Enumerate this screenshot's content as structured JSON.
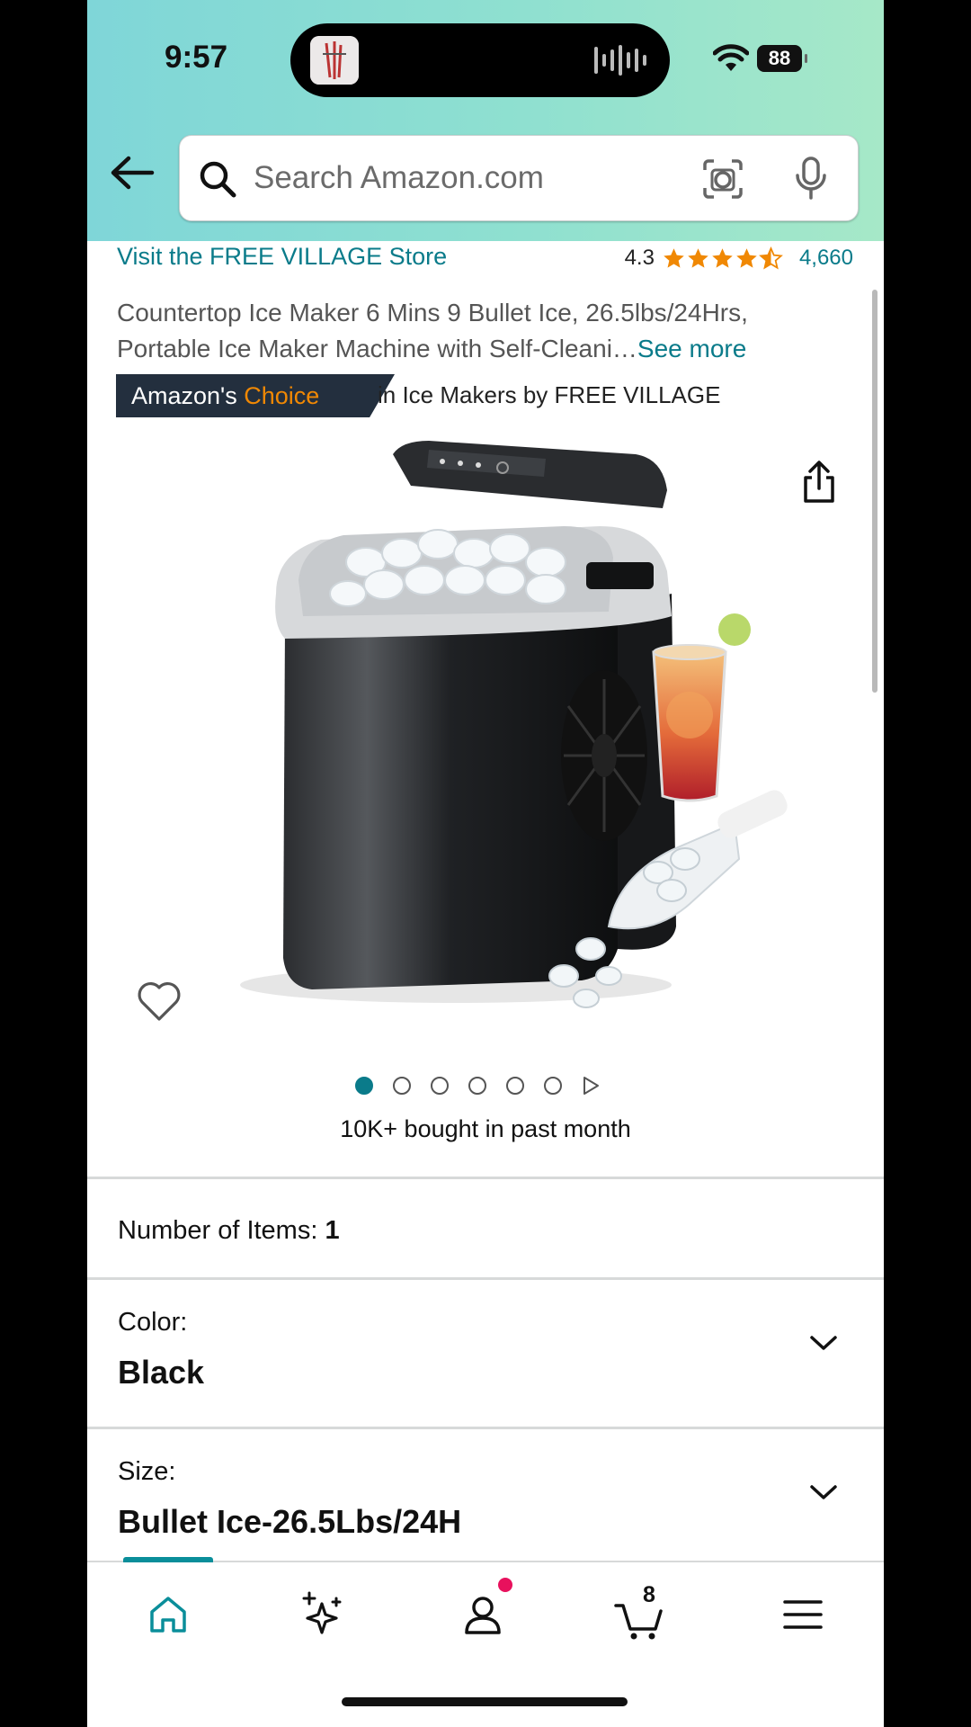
{
  "status_bar": {
    "time": "9:57",
    "battery": "88"
  },
  "search": {
    "placeholder": "Search Amazon.com"
  },
  "product": {
    "store_link": "Visit the FREE VILLAGE Store",
    "rating": "4.3",
    "rating_count": "4,660",
    "title": "Countertop Ice Maker 6 Mins 9 Bullet Ice, 26.5lbs/24Hrs, Portable Ice Maker Machine with Self-Cleani…",
    "see_more": "See more",
    "badge_prefix": "Amazon's ",
    "badge_accent": "Choice",
    "badge_category": "in Ice Makers by FREE VILLAGE",
    "image_count": 6,
    "active_image": 1,
    "bought": "10K+ bought in past month"
  },
  "options": {
    "items_label": "Number of Items:",
    "items_value": "1",
    "color_label": "Color:",
    "color_value": "Black",
    "size_label": "Size:",
    "size_value": "Bullet Ice-26.5Lbs/24H"
  },
  "bottom_nav": {
    "cart_count": "8"
  },
  "colors": {
    "link": "#0a7b8a",
    "badge_bg": "#232f3e",
    "badge_accent": "#f08804",
    "star": "#f08804"
  }
}
